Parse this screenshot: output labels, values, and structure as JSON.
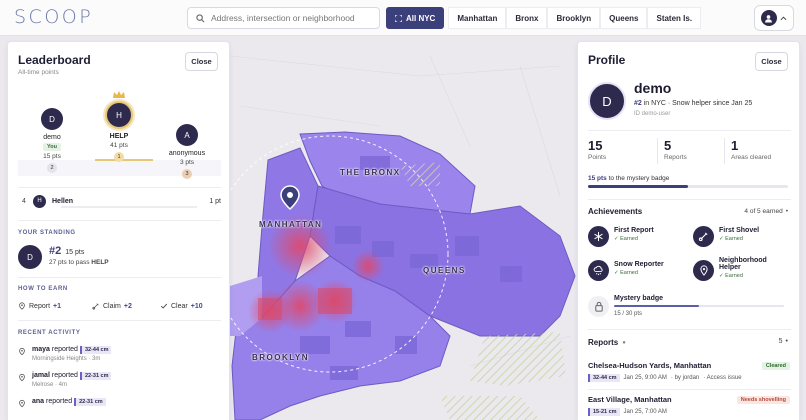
{
  "app": {
    "logo": "SCOOP"
  },
  "search": {
    "placeholder": "Address, intersection or neighborhood"
  },
  "boroughs": {
    "all_label": "All NYC",
    "items": [
      "Manhattan",
      "Bronx",
      "Brooklyn",
      "Queens",
      "Staten Is."
    ]
  },
  "user_menu": {
    "icon": "person-icon",
    "caret": "chevron-up-icon"
  },
  "map": {
    "labels": {
      "bronx": "THE BRONX",
      "manhattan": "MANHATTAN",
      "queens": "QUEENS",
      "brooklyn": "BROOKLYN"
    },
    "colors": {
      "land": "#8f78e6",
      "land_dark": "#6d5bc2",
      "heat": "#d95a7a",
      "water": "#e9e7ec"
    }
  },
  "leaderboard": {
    "title": "Leaderboard",
    "subtitle": "All-time points",
    "close_label": "Close",
    "podium": [
      {
        "initial": "D",
        "name": "demo",
        "tag": "You",
        "points": "15 pts",
        "rank": "2"
      },
      {
        "initial": "H",
        "name": "HELP",
        "points": "41 pts",
        "rank": "1",
        "crown": "crown-icon"
      },
      {
        "initial": "A",
        "name": "anonymous",
        "points": "3 pts",
        "rank": "3"
      }
    ],
    "row4": {
      "rank": "4",
      "initial": "H",
      "name": "Hellen",
      "points": "1 pt"
    },
    "standing": {
      "heading": "YOUR STANDING",
      "initial": "D",
      "rank": "#2",
      "points": "15 pts",
      "to_pass_text": "27 pts to pass",
      "to_pass_name": "HELP"
    },
    "how_to_earn": {
      "heading": "HOW TO EARN",
      "items": [
        {
          "label": "Report",
          "value": "+1"
        },
        {
          "label": "Claim",
          "value": "+2"
        },
        {
          "label": "Clear",
          "value": "+10"
        }
      ]
    },
    "activity": {
      "heading": "RECENT ACTIVITY",
      "items": [
        {
          "user": "maya",
          "verb": "reported",
          "chip": "32-44 cm",
          "sub": "Morningside Heights · 3m"
        },
        {
          "user": "jamal",
          "verb": "reported",
          "chip": "22-31 cm",
          "sub": "Melrose · 4m"
        },
        {
          "user": "ana",
          "verb": "reported",
          "chip": "22-31 cm",
          "sub": ""
        }
      ]
    }
  },
  "profile": {
    "title": "Profile",
    "close_label": "Close",
    "initial": "D",
    "name": "demo",
    "line_rank": "#2",
    "line_rest": "in NYC · Snow helper since Jan 25",
    "id": "ID demo-user",
    "stats": [
      {
        "value": "15",
        "label": "Points"
      },
      {
        "value": "5",
        "label": "Reports"
      },
      {
        "value": "1",
        "label": "Areas cleared"
      }
    ],
    "mystery": {
      "pts": "15 pts",
      "text": "to the mystery badge",
      "progress": 0.5
    },
    "achievements": {
      "heading": "Achievements",
      "count": "4 of 5 earned",
      "items": [
        {
          "title": "First Report",
          "state": "✓ Earned",
          "icon": "snowflake-icon"
        },
        {
          "title": "First Shovel",
          "state": "✓ Earned",
          "icon": "shovel-icon"
        },
        {
          "title": "Snow Reporter",
          "state": "✓ Earned",
          "icon": "cloud-snow-icon"
        },
        {
          "title": "Neighborhood Helper",
          "state": "✓ Earned",
          "icon": "location-pin-icon"
        }
      ],
      "locked": {
        "title": "Mystery badge",
        "progress_text": "15 / 30 pts",
        "progress": 0.5,
        "icon": "lock-icon"
      }
    },
    "reports": {
      "heading": "Reports",
      "count": "5",
      "items": [
        {
          "title": "Chelsea-Hudson Yards, Manhattan",
          "badge": "Cleared",
          "chip": "32-44 cm",
          "date": "Jan 25, 9:00 AM",
          "by": "· by jordan",
          "note": "· Access issue"
        },
        {
          "title": "East Village, Manhattan",
          "badge": "Needs shovelling",
          "chip": "15-21 cm",
          "date": "Jan 25, 7:00 AM",
          "by": "",
          "note": ""
        }
      ]
    }
  }
}
